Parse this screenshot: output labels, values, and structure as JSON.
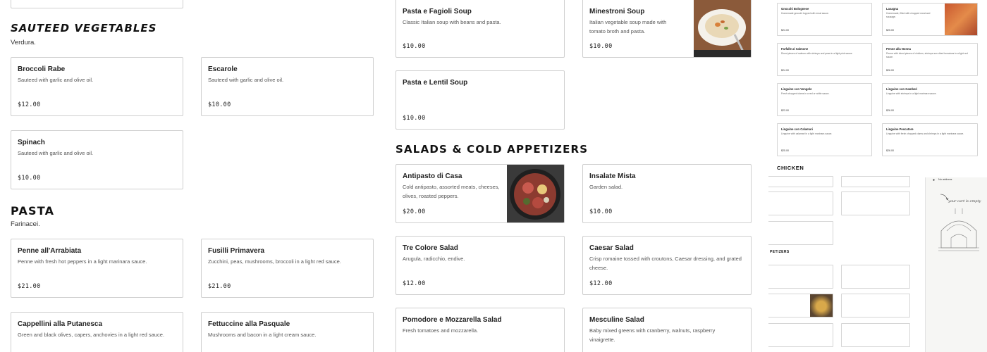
{
  "sections": {
    "sauteed": {
      "title": "SAUTEED VEGETABLES",
      "subtitle": "Verdura."
    },
    "pasta": {
      "title": "PASTA",
      "subtitle": "Farinacei."
    },
    "salads": {
      "title": "SALADS & COLD APPETIZERS"
    }
  },
  "veg_items": [
    {
      "name": "Broccoli Rabe",
      "desc": "Sauteed with garlic and olive oil.",
      "price": "$12.00"
    },
    {
      "name": "Escarole",
      "desc": "Sauteed with garlic and olive oil.",
      "price": "$10.00"
    },
    {
      "name": "Spinach",
      "desc": "Sauteed with garlic and olive oil.",
      "price": "$10.00"
    }
  ],
  "pasta_items": [
    {
      "name": "Penne all'Arrabiata",
      "desc": "Penne with fresh hot peppers in a light marinara sauce.",
      "price": "$21.00"
    },
    {
      "name": "Fusilli Primavera",
      "desc": "Zucchini, peas, mushrooms, broccoli in a light red sauce.",
      "price": "$21.00"
    },
    {
      "name": "Cappellini alla Putanesca",
      "desc": "Green and black olives, capers, anchovies in a light red sauce.",
      "price": ""
    },
    {
      "name": "Fettuccine alla Pasquale",
      "desc": "Mushrooms and bacon in a light cream sauce.",
      "price": ""
    }
  ],
  "soup_items": [
    {
      "name": "Pasta e Fagioli Soup",
      "desc": "Classic Italian soup with beans and pasta.",
      "price": "$10.00"
    },
    {
      "name": "Minestroni Soup",
      "desc": "Italian vegetable soup made with tomato broth and pasta.",
      "price": "$10.00",
      "image": "soup-bowl"
    },
    {
      "name": "Pasta e Lentil Soup",
      "desc": "",
      "price": "$10.00"
    }
  ],
  "salad_items": [
    {
      "name": "Antipasto di Casa",
      "desc": "Cold antipasto, assorted meats, cheeses, olives, roasted peppers.",
      "price": "$20.00",
      "image": "antipasto-platter"
    },
    {
      "name": "Insalate Mista",
      "desc": "Garden salad.",
      "price": "$10.00"
    },
    {
      "name": "Tre Colore Salad",
      "desc": "Arugula, radicchio, endive.",
      "price": "$12.00"
    },
    {
      "name": "Caesar Salad",
      "desc": "Crisp romaine tossed with croutons, Caesar dressing, and grated cheese.",
      "price": "$12.00"
    },
    {
      "name": "Pomodore e Mozzarella Salad",
      "desc": "Fresh tomatoes and mozzarella.",
      "price": ""
    },
    {
      "name": "Mesculine Salad",
      "desc": "Baby mixed greens with cranberry, walnuts, raspberry vinaigrette.",
      "price": ""
    }
  ],
  "preview": {
    "mini_items": [
      {
        "name": "Gnocchi Bolognese",
        "desc": "Homemade gnocchi topped with meat sauce.",
        "price": "$24.00"
      },
      {
        "name": "Lasagna",
        "desc": "Homemade, filled with chopped meat and sausage.",
        "price": "$25.00"
      },
      {
        "name": "Farfalle al Salmone",
        "desc": "Diced pieces of salmon with shrimps and peas in a light pink sauce.",
        "price": "$24.00"
      },
      {
        "name": "Penne alla Nonna",
        "desc": "Penne with diced pieces of chicken, shrimps sun dried tomatoes in a light red sauce.",
        "price": "$26.00"
      },
      {
        "name": "Linguine con Vongole",
        "desc": "Fresh chopped clams in a red or white sauce.",
        "price": "$23.00"
      },
      {
        "name": "Linguine con Gamberi",
        "desc": "Linguine with shrimps in a light marinara sauce.",
        "price": "$26.00"
      },
      {
        "name": "Linguine con Calamari",
        "desc": "Linguine with calamari in a light marinara sauce.",
        "price": "$25.00"
      },
      {
        "name": "Linguine Pescatore",
        "desc": "Linguine with fresh chopped clams and shrimps in a light marinara sauce.",
        "price": "$26.00"
      }
    ],
    "chicken_title": "CHICKEN",
    "appetizers_title": "PETIZERS",
    "address_label": "No address",
    "cart_empty": "your cart is empty"
  }
}
